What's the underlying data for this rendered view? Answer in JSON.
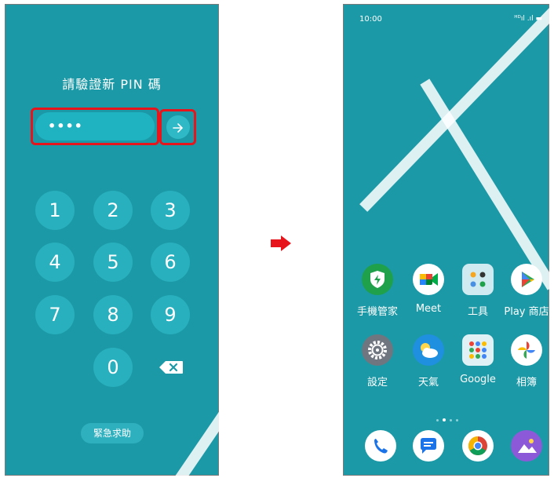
{
  "left_screen": {
    "title": "請驗證新 PIN 碼",
    "pin_masked": "••••",
    "submit_icon": "arrow-right-icon",
    "keypad": [
      "1",
      "2",
      "3",
      "4",
      "5",
      "6",
      "7",
      "8",
      "9",
      "0"
    ],
    "delete_icon": "backspace-icon",
    "emergency_label": "緊急求助"
  },
  "transition_icon": "red-arrow-right-icon",
  "right_screen": {
    "status_time": "10:00",
    "status_icons": "ᴴᴰıl .ıl ▬",
    "apps": [
      {
        "label": "手機管家",
        "icon": "phone-manager-icon"
      },
      {
        "label": "Meet",
        "icon": "google-meet-icon"
      },
      {
        "label": "工具",
        "icon": "tools-folder-icon"
      },
      {
        "label": "Play 商店",
        "icon": "play-store-icon"
      },
      {
        "label": "設定",
        "icon": "settings-icon"
      },
      {
        "label": "天氣",
        "icon": "weather-icon"
      },
      {
        "label": "Google",
        "icon": "google-folder-icon"
      },
      {
        "label": "相簿",
        "icon": "photos-icon"
      }
    ],
    "page_indicator": {
      "pages": 4,
      "current": 2
    },
    "dock": [
      {
        "icon": "phone-icon"
      },
      {
        "icon": "messages-icon"
      },
      {
        "icon": "chrome-icon"
      },
      {
        "icon": "gallery-icon"
      }
    ]
  },
  "colors": {
    "screen_bg": "#1c99a6",
    "highlight": "#e8141c"
  }
}
